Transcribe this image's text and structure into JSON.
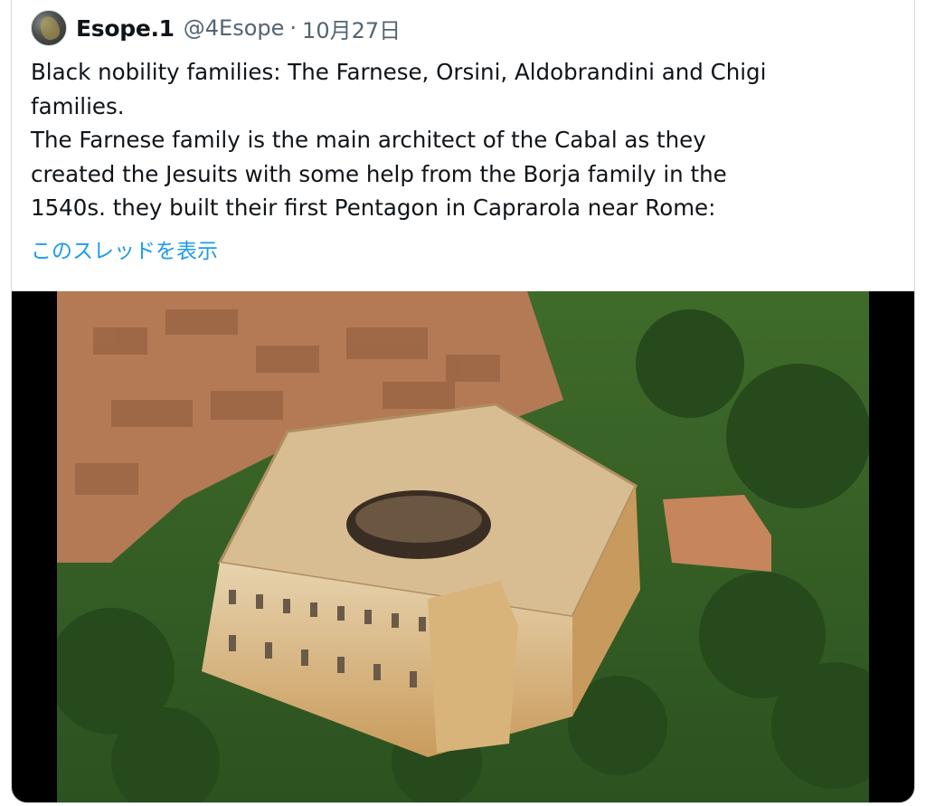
{
  "tweet": {
    "author_name": "Esope.1",
    "author_handle": "@4Esope",
    "separator": "·",
    "date": "10月27日",
    "text": "Black nobility families: The Farnese, Orsini, Aldobrandini and Chigi\nfamilies.\nThe Farnese family is the main architect of the Cabal as they\ncreated the Jesuits with some help from the Borja family in the\n1540s. they built their first Pentagon in Caprarola near Rome:",
    "show_thread_label": "このスレッドを表示"
  },
  "media": {
    "icon": "photo-image"
  },
  "colors": {
    "link": "#1d9bf0",
    "secondary_text": "#536471",
    "primary_text": "#0f1419",
    "border": "#cfd9de"
  }
}
